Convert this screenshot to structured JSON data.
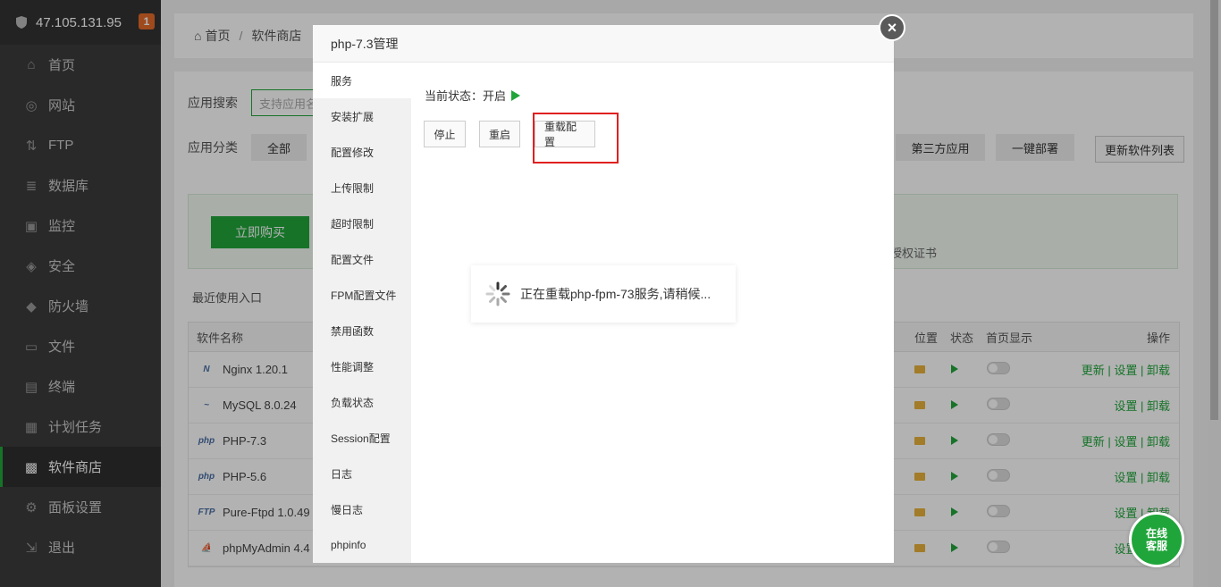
{
  "sidebar": {
    "server_ip": "47.105.131.95",
    "badge": "1",
    "items": [
      {
        "label": "首页",
        "icon": "home-icon"
      },
      {
        "label": "网站",
        "icon": "globe-icon"
      },
      {
        "label": "FTP",
        "icon": "ftp-icon"
      },
      {
        "label": "数据库",
        "icon": "database-icon"
      },
      {
        "label": "监控",
        "icon": "monitor-icon"
      },
      {
        "label": "安全",
        "icon": "shield-check-icon"
      },
      {
        "label": "防火墙",
        "icon": "firewall-icon"
      },
      {
        "label": "文件",
        "icon": "folder-icon"
      },
      {
        "label": "终端",
        "icon": "terminal-icon"
      },
      {
        "label": "计划任务",
        "icon": "calendar-icon"
      },
      {
        "label": "软件商店",
        "icon": "apps-icon"
      },
      {
        "label": "面板设置",
        "icon": "settings-icon"
      },
      {
        "label": "退出",
        "icon": "logout-icon"
      }
    ]
  },
  "breadcrumb": {
    "home": "首页",
    "sep": "/",
    "current": "软件商店"
  },
  "store": {
    "search_label": "应用搜索",
    "search_placeholder": "支持应用名",
    "category_label": "应用分类",
    "cat_all": "全部",
    "cat_third": "第三方应用",
    "cat_deploy": "一键部署",
    "update_list": "更新软件列表",
    "buy_now": "立即购买",
    "cert_text": "授权证书",
    "recent": "最近使用入口",
    "table_headers": {
      "name": "软件名称",
      "pos": "位置",
      "status": "状态",
      "home": "首页显示",
      "op": "操作"
    },
    "rows": [
      {
        "icon": "N",
        "name": "Nginx 1.20.1",
        "op": "更新 | 设置 | 卸载"
      },
      {
        "icon": "~",
        "name": "MySQL 8.0.24",
        "op": "设置 | 卸载"
      },
      {
        "icon": "php",
        "name": "PHP-7.3",
        "op": "更新 | 设置 | 卸载"
      },
      {
        "icon": "php",
        "name": "PHP-5.6",
        "op": "设置 | 卸载"
      },
      {
        "icon": "FTP",
        "name": "Pure-Ftpd 1.0.49",
        "op": "设置 | 卸载"
      },
      {
        "icon": "⛵",
        "name": "phpMyAdmin 4.4",
        "op": "设置 | 卸载"
      }
    ]
  },
  "modal": {
    "title": "php-7.3管理",
    "nav": [
      "服务",
      "安装扩展",
      "配置修改",
      "上传限制",
      "超时限制",
      "配置文件",
      "FPM配置文件",
      "禁用函数",
      "性能调整",
      "负载状态",
      "Session配置",
      "日志",
      "慢日志",
      "phpinfo"
    ],
    "status_label": "当前状态：",
    "status_value": "开启",
    "btn_stop": "停止",
    "btn_restart": "重启",
    "btn_reload": "重载配置"
  },
  "loading": {
    "text": "正在重载php-fpm-73服务,请稍候..."
  },
  "chat": {
    "line1": "在线",
    "line2": "客服"
  },
  "colors": {
    "accent": "#20a53a",
    "highlight": "#e02020"
  }
}
